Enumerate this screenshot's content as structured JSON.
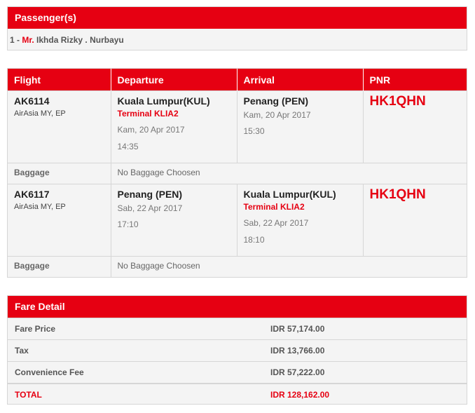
{
  "passengers": {
    "header": "Passenger(s)",
    "list": [
      {
        "index": "1 -",
        "title": "Mr.",
        "name": "Ikhda Rizky . Nurbayu"
      }
    ]
  },
  "flight_table": {
    "headers": {
      "flight": "Flight",
      "departure": "Departure",
      "arrival": "Arrival",
      "pnr": "PNR"
    },
    "segments": [
      {
        "flight_no": "AK6114",
        "airline": "AirAsia MY, EP",
        "departure": {
          "city": "Kuala Lumpur(KUL)",
          "terminal": "Terminal KLIA2",
          "date": "Kam, 20 Apr 2017",
          "time": "14:35"
        },
        "arrival": {
          "city": "Penang (PEN)",
          "terminal": "",
          "date": "Kam, 20 Apr 2017",
          "time": "15:30"
        },
        "pnr": "HK1QHN",
        "baggage_label": "Baggage",
        "baggage_value": "No Baggage Choosen"
      },
      {
        "flight_no": "AK6117",
        "airline": "AirAsia MY, EP",
        "departure": {
          "city": "Penang (PEN)",
          "terminal": "",
          "date": "Sab, 22 Apr 2017",
          "time": "17:10"
        },
        "arrival": {
          "city": "Kuala Lumpur(KUL)",
          "terminal": "Terminal KLIA2",
          "date": "Sab, 22 Apr 2017",
          "time": "18:10"
        },
        "pnr": "HK1QHN",
        "baggage_label": "Baggage",
        "baggage_value": "No Baggage Choosen"
      }
    ]
  },
  "fare": {
    "header": "Fare Detail",
    "rows": [
      {
        "label": "Fare Price",
        "amount": "IDR 57,174.00"
      },
      {
        "label": "Tax",
        "amount": "IDR 13,766.00"
      },
      {
        "label": "Convenience Fee",
        "amount": "IDR 57,222.00"
      }
    ],
    "total": {
      "label": "TOTAL",
      "amount": "IDR 128,162.00"
    }
  },
  "colors": {
    "accent": "#e60012",
    "panel": "#f4f4f4",
    "border": "#d6d6d6"
  }
}
